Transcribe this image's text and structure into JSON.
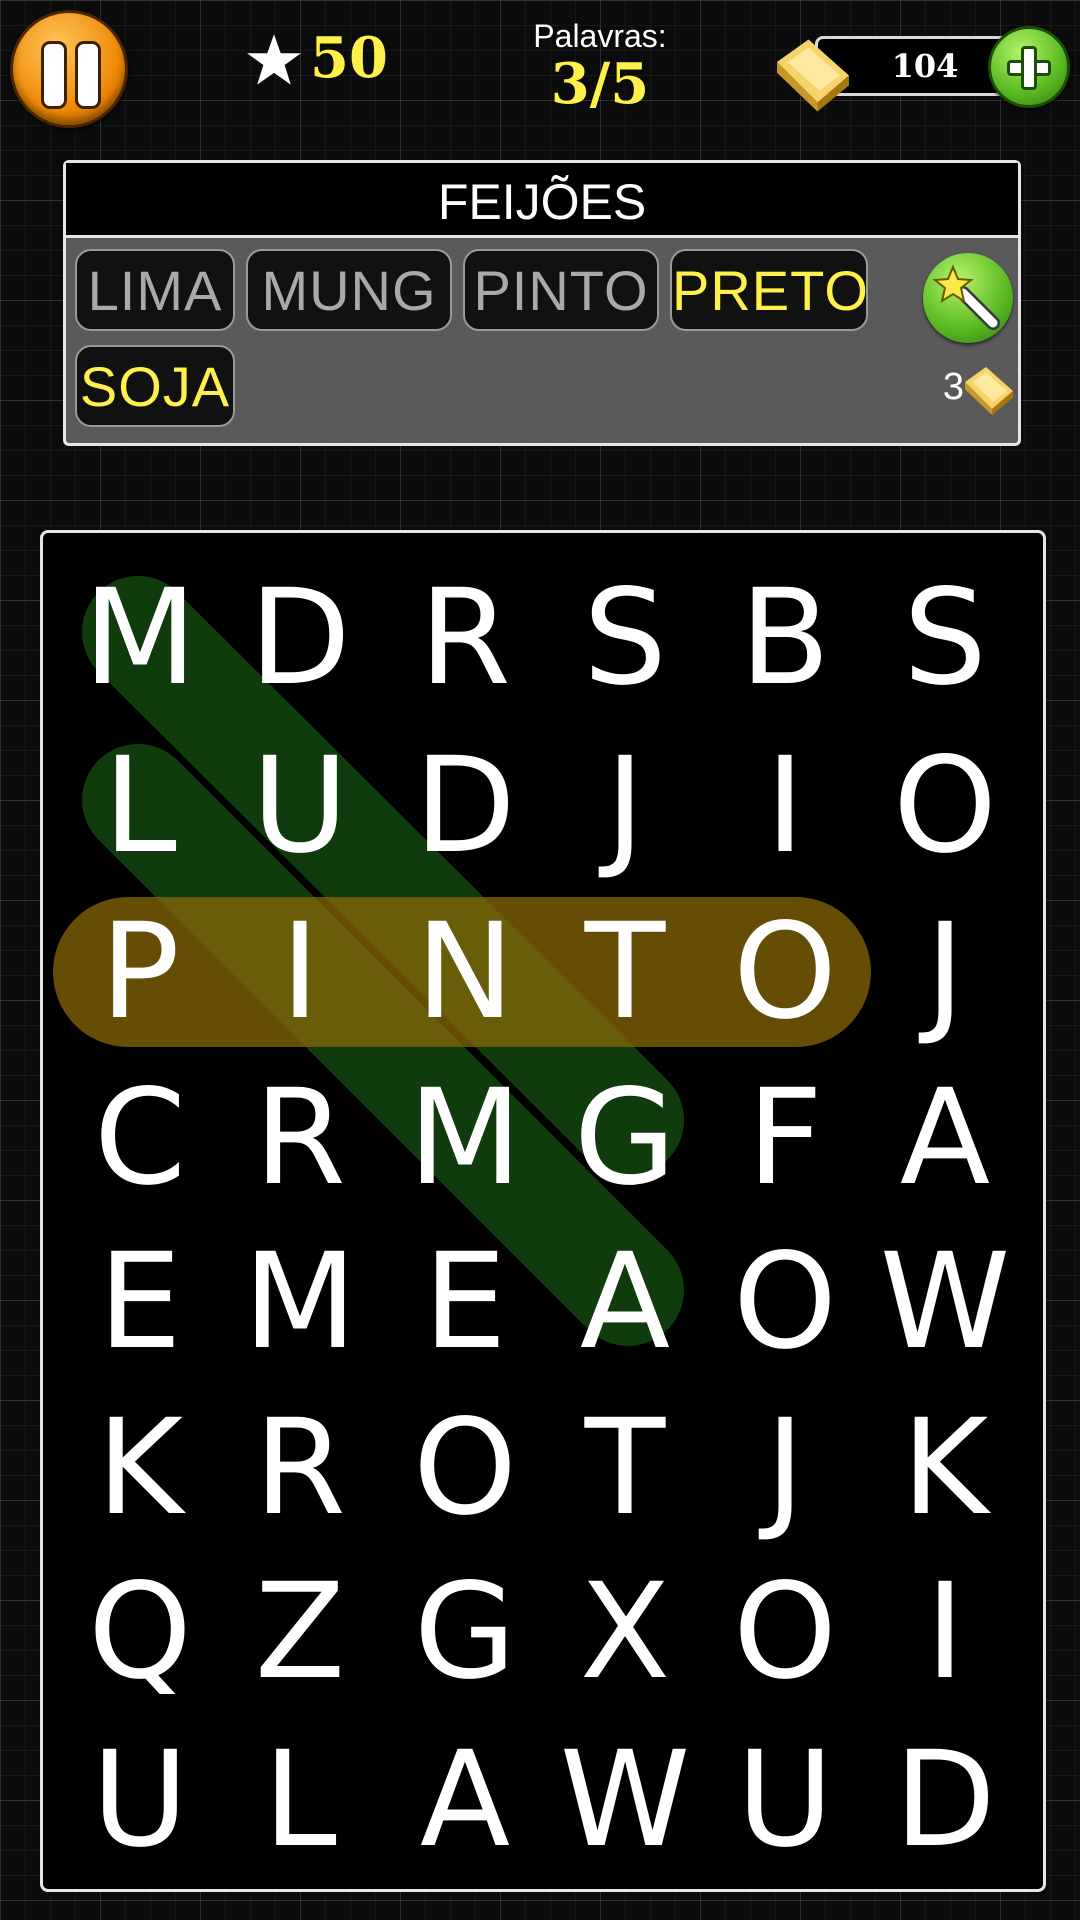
{
  "header": {
    "score": "50",
    "words_label": "Palavras:",
    "words_progress": "3/5",
    "gold": "104"
  },
  "icons": {
    "pause": "pause-icon",
    "star": "star-icon",
    "gold": "gold-bar-icon",
    "add": "plus-icon",
    "hint": "magic-wand-icon"
  },
  "colors": {
    "found_word_text": "#a9a9a9",
    "open_word_text": "#fff14a",
    "highlight_green": "#1e6b16",
    "highlight_gold": "#8c6b08"
  },
  "panel": {
    "category": "FEIJÕES",
    "words": [
      {
        "text": "LIMA",
        "found": true
      },
      {
        "text": "MUNG",
        "found": true
      },
      {
        "text": "PINTO",
        "found": true
      },
      {
        "text": "PRETO",
        "found": false
      },
      {
        "text": "SOJA",
        "found": false
      }
    ],
    "hint_cost": "3"
  },
  "board": {
    "rows": [
      [
        "M",
        "D",
        "R",
        "S",
        "B",
        "S"
      ],
      [
        "L",
        "U",
        "D",
        "J",
        "I",
        "O"
      ],
      [
        "P",
        "I",
        "N",
        "T",
        "O",
        "J"
      ],
      [
        "C",
        "R",
        "M",
        "G",
        "F",
        "A"
      ],
      [
        "E",
        "M",
        "E",
        "A",
        "O",
        "W"
      ],
      [
        "K",
        "R",
        "O",
        "T",
        "J",
        "K"
      ],
      [
        "Q",
        "Z",
        "G",
        "X",
        "O",
        "I"
      ],
      [
        "U",
        "L",
        "A",
        "W",
        "U",
        "D"
      ]
    ]
  }
}
